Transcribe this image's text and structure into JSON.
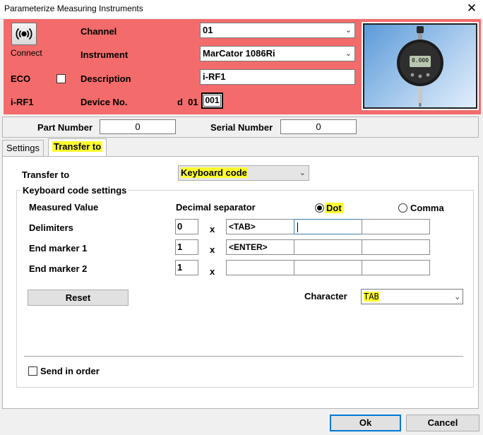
{
  "window": {
    "title": "Parameterize Measuring Instruments",
    "close_glyph": "✕"
  },
  "header": {
    "connect_label": "Connect",
    "eco_label": "ECO",
    "eco_checked": false,
    "device_name": "i-RF1",
    "channel_label": "Channel",
    "channel_value": "01",
    "instrument_label": "Instrument",
    "instrument_value": "MarCator 1086Ri",
    "description_label": "Description",
    "description_value": "i-RF1",
    "device_no_label": "Device No.",
    "device_no_prefix": "d  01",
    "device_no_value": "001",
    "gauge_display": "0.000",
    "colors": {
      "background": "#f36b6b"
    }
  },
  "part_row": {
    "part_number_label": "Part Number",
    "part_number_value": "0",
    "serial_number_label": "Serial Number",
    "serial_number_value": "0"
  },
  "tabs": [
    {
      "label": "Settings",
      "active": false
    },
    {
      "label": "Transfer to",
      "active": true
    }
  ],
  "transfer": {
    "transfer_to_label": "Transfer to",
    "transfer_to_value": "Keyboard code",
    "group_title": "Keyboard code settings",
    "measured_value_label": "Measured Value",
    "decimal_separator_label": "Decimal separator",
    "dot_label": "Dot",
    "comma_label": "Comma",
    "selected_separator": "Dot",
    "times_glyph": "x",
    "rows": [
      {
        "label": "Delimiters",
        "count": "0",
        "cells": [
          "<TAB>",
          "",
          ""
        ]
      },
      {
        "label": "End marker 1",
        "count": "1",
        "cells": [
          "<ENTER>",
          "",
          ""
        ]
      },
      {
        "label": "End marker 2",
        "count": "1",
        "cells": [
          "",
          "",
          ""
        ]
      }
    ],
    "reset_label": "Reset",
    "character_label": "Character",
    "character_value": "TAB",
    "send_in_order_label": "Send in order",
    "send_in_order_checked": false
  },
  "footer": {
    "ok_label": "Ok",
    "cancel_label": "Cancel"
  },
  "icons": {
    "connect": "broadcast-icon",
    "dropdown": "chevron-down-icon",
    "close": "close-icon"
  },
  "colors": {
    "highlight": "#ffff2e",
    "focus": "#3c7fb1"
  }
}
